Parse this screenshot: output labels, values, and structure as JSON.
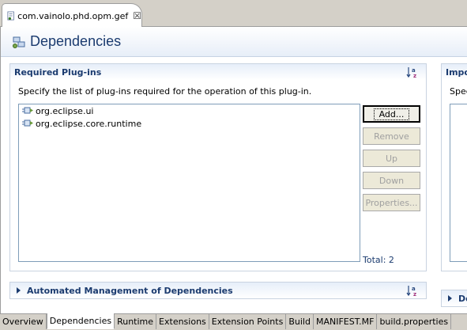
{
  "editor": {
    "tab_title": "com.vainolo.phd.opm.gef",
    "close_glyph": "☒"
  },
  "form": {
    "title": "Dependencies"
  },
  "required_plugins": {
    "title": "Required Plug-ins",
    "description": "Specify the list of plug-ins required for the operation of this plug-in.",
    "items": [
      {
        "label": "org.eclipse.ui",
        "icon": "plugin-icon"
      },
      {
        "label": "org.eclipse.core.runtime",
        "icon": "plugin-icon"
      }
    ],
    "buttons": {
      "add": "Add...",
      "remove": "Remove",
      "up": "Up",
      "down": "Down",
      "properties": "Properties..."
    },
    "total": "Total: 2"
  },
  "automated": {
    "title": "Automated Management of Dependencies"
  },
  "imported_packages": {
    "title": "Impo",
    "description": "Spec"
  },
  "dependency_analysis": {
    "title": "De"
  },
  "page_tabs": [
    {
      "label": "Overview"
    },
    {
      "label": "Dependencies"
    },
    {
      "label": "Runtime"
    },
    {
      "label": "Extensions"
    },
    {
      "label": "Extension Points"
    },
    {
      "label": "Build"
    },
    {
      "label": "MANIFEST.MF"
    },
    {
      "label": "build.properties"
    }
  ],
  "colors": {
    "title_text": "#1b3b6f",
    "section_header": "#e6eef9",
    "chrome": "#d4d0c8"
  }
}
